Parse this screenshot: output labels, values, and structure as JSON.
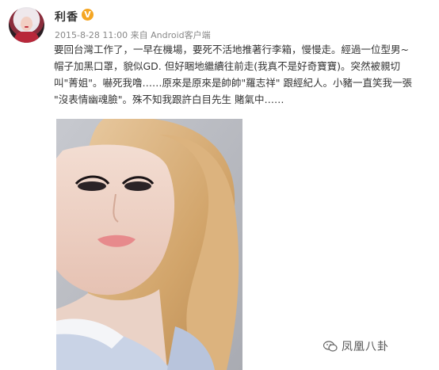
{
  "post": {
    "author": "利香",
    "verified_badge": "V",
    "date": "2015-8-28 11:00",
    "source_prefix": "来自",
    "source": "Android客户端",
    "lines": [
      "要回台灣工作了，一早在機場，要死不活地推著行李箱，慢慢走。經過一位型男~",
      "帽子加黑口罩，貌似GD. 但好睏地繼續往前走(我真不是好奇寶寶)。突然被親切",
      "叫\"菁姐\"。嚇死我噜……原來是原來是帥帥\"羅志祥\" 跟經紀人。小豬一直笑我一張",
      "\"沒表情幽魂臉\"。殊不知我跟許白目先生 賭氣中……"
    ]
  },
  "watermark": {
    "text": "凤凰八卦",
    "icon": "wechat-icon"
  },
  "colors": {
    "badge": "#f5a623",
    "text": "#333333",
    "meta": "#888888"
  }
}
